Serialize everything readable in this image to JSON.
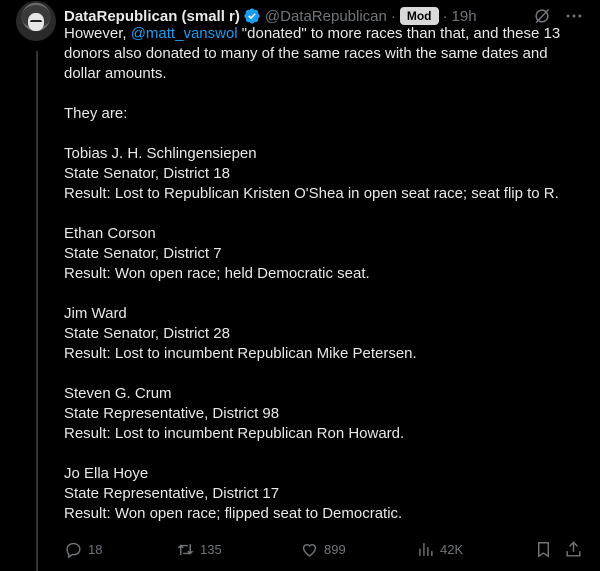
{
  "author": {
    "name": "DataRepublican (small r)",
    "handle": "@DataRepublican",
    "separator": "·",
    "badge": "Mod",
    "time": "19h"
  },
  "tweet": {
    "intro_prefix": "However, ",
    "mention": "@matt_vanswol",
    "intro_suffix": " \"donated\" to more races than that, and these 13 donors also donated to many of the same races with the same dates and dollar amounts.",
    "they_are": "They are:",
    "entries": [
      {
        "name": "Tobias J. H. Schlingensiepen",
        "office": "State Senator, District 18",
        "result": "Result: Lost to Republican Kristen O'Shea in open seat race; seat flip to R."
      },
      {
        "name": "Ethan Corson",
        "office": "State Senator, District 7",
        "result": "Result: Won open race; held Democratic seat."
      },
      {
        "name": "Jim Ward",
        "office": "State Senator, District 28",
        "result": "Result: Lost to incumbent Republican Mike Petersen."
      },
      {
        "name": "Steven G. Crum",
        "office": "State Representative, District 98",
        "result": "Result: Lost to incumbent Republican Ron Howard."
      },
      {
        "name": "Jo Ella Hoye",
        "office": "State Representative, District 17",
        "result": "Result: Won open race; flipped seat to Democratic."
      }
    ]
  },
  "actions": {
    "replies": "18",
    "reposts": "135",
    "likes": "899",
    "views": "42K"
  },
  "colors": {
    "background": "#000000",
    "text": "#e7e9ea",
    "muted": "#71767b",
    "accent": "#1d9bf0"
  }
}
